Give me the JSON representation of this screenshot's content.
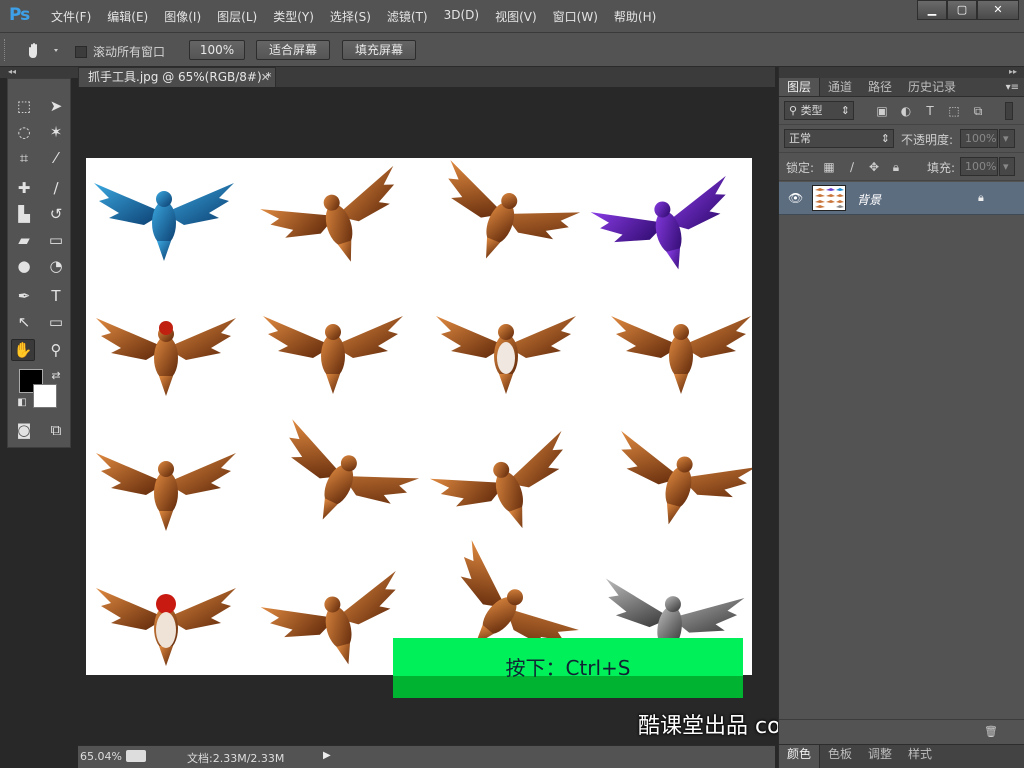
{
  "app": {
    "logo": "Ps",
    "menus": [
      "文件(F)",
      "编辑(E)",
      "图像(I)",
      "图层(L)",
      "类型(Y)",
      "选择(S)",
      "滤镜(T)",
      "3D(D)",
      "视图(V)",
      "窗口(W)",
      "帮助(H)"
    ],
    "window_buttons": [
      "minimize",
      "maximize",
      "close"
    ]
  },
  "options": {
    "scroll_all_label": "滚动所有窗口",
    "zoom_100_label": "100%",
    "fit_screen_label": "适合屏幕",
    "fill_screen_label": "填充屏幕"
  },
  "tools": [
    "marquee-icon",
    "move-icon",
    "lasso-icon",
    "magic-wand-icon",
    "crop-icon",
    "eyedropper-icon",
    "healing-brush-icon",
    "brush-icon",
    "clone-stamp-icon",
    "history-brush-icon",
    "eraser-icon",
    "gradient-icon",
    "blur-icon",
    "dodge-icon",
    "pen-icon",
    "type-icon",
    "path-selection-icon",
    "rectangle-icon",
    "hand-icon",
    "zoom-icon"
  ],
  "document": {
    "tab_title": "抓手工具.jpg @ 65%(RGB/8#) *",
    "zoom": "65.04%",
    "size_info": "文档:2.33M/2.33M"
  },
  "colors": {
    "foreground": "#000000",
    "background": "#ffffff",
    "accent_green": "#00f05a"
  },
  "overlay": {
    "hint": "按下：Ctrl+S",
    "watermark": "酷课堂出品 coolketang.com"
  },
  "layers_panel": {
    "tabs": [
      "图层",
      "通道",
      "路径",
      "历史记录"
    ],
    "filter_kind": "类型",
    "blend_mode": "正常",
    "opacity_label": "不透明度:",
    "opacity_value": "100%",
    "lock_label": "锁定:",
    "fill_label": "填充:",
    "fill_value": "100%",
    "layers": [
      {
        "name": "背景",
        "visible": true,
        "locked": true
      }
    ]
  },
  "bottom_panel": {
    "tabs": [
      "颜色",
      "色板",
      "调整",
      "样式"
    ]
  }
}
